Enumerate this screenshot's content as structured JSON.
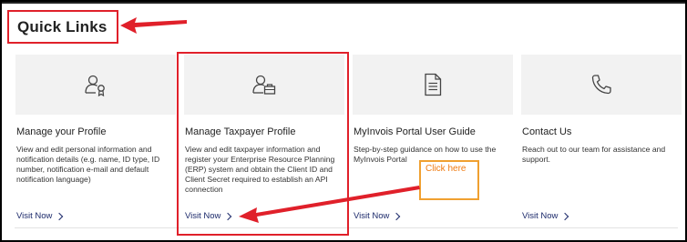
{
  "section_title": "Quick Links",
  "cards": [
    {
      "icon": "person-badge-icon",
      "title": "Manage your Profile",
      "description": "View and edit personal information and notification details (e.g. name, ID type, ID number, notification e-mail and default notification language)",
      "link": "Visit Now"
    },
    {
      "icon": "person-briefcase-icon",
      "title": "Manage Taxpayer Profile",
      "description": "View and edit taxpayer information and register your Enterprise Resource Planning (ERP) system and obtain the Client ID and Client Secret required to establish an API connection",
      "link": "Visit Now"
    },
    {
      "icon": "document-icon",
      "title": "MyInvois Portal User Guide",
      "description": "Step-by-step guidance on how to use the MyInvois Portal",
      "link": "Visit Now"
    },
    {
      "icon": "phone-icon",
      "title": "Contact Us",
      "description": "Reach out to our team for assistance and support.",
      "link": "Visit Now"
    }
  ],
  "callout": {
    "text": "Click here"
  },
  "colors": {
    "annotation_red": "#e0202a",
    "callout_orange": "#f0a030",
    "link_navy": "#1c2a6b"
  }
}
